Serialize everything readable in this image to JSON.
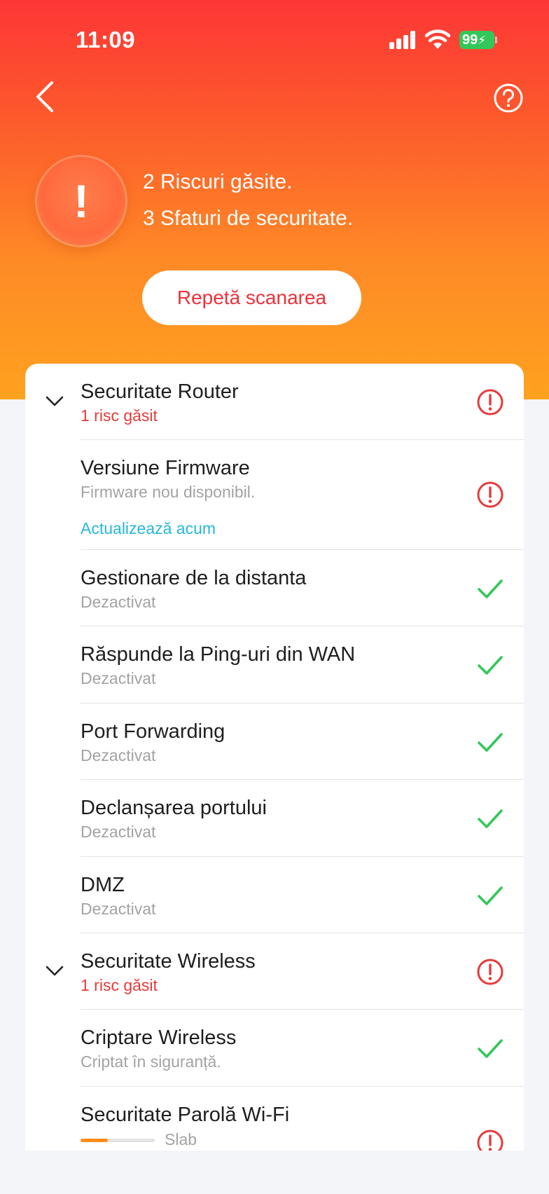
{
  "status_bar": {
    "time": "11:09",
    "battery": "99"
  },
  "summary": {
    "risks": "2 Riscuri găsite.",
    "tips": "3 Sfaturi de securitate.",
    "rescan_label": "Repetă scanarea"
  },
  "sections": {
    "router": {
      "title": "Securitate Router",
      "subtitle": "1 risc găsit"
    },
    "wireless": {
      "title": "Securitate Wireless",
      "subtitle": "1 risc găsit"
    }
  },
  "items": {
    "firmware": {
      "title": "Versiune Firmware",
      "subtitle": "Firmware nou disponibil.",
      "action": "Actualizează acum"
    },
    "remote": {
      "title": "Gestionare de la distanta",
      "subtitle": "Dezactivat"
    },
    "ping": {
      "title": "Răspunde la Ping-uri din WAN",
      "subtitle": "Dezactivat"
    },
    "port_forwarding": {
      "title": "Port Forwarding",
      "subtitle": "Dezactivat"
    },
    "port_trigger": {
      "title": "Declanșarea portului",
      "subtitle": "Dezactivat"
    },
    "dmz": {
      "title": "DMZ",
      "subtitle": "Dezactivat"
    },
    "encryption": {
      "title": "Criptare Wireless",
      "subtitle": "Criptat în siguranță."
    },
    "password": {
      "title": "Securitate Parolă Wi-Fi",
      "strength_label": "Slab",
      "strength": 0.37
    }
  },
  "colors": {
    "risk": "#e63a3a",
    "ok": "#34c759",
    "link": "#26b8d6",
    "weak": "#ff8c1a"
  }
}
